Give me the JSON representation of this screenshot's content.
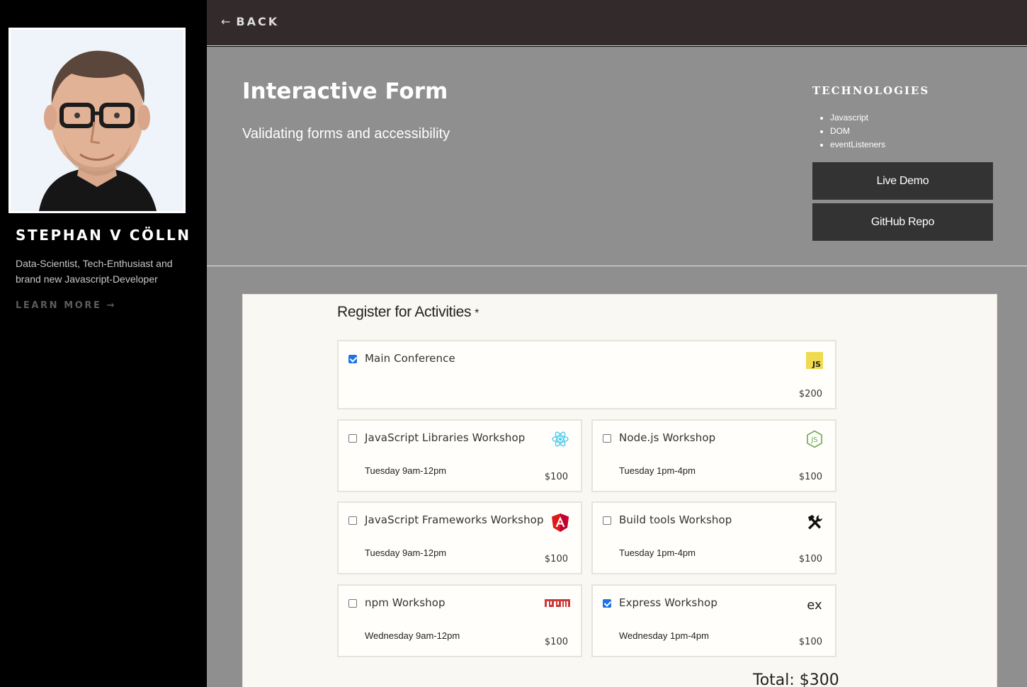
{
  "sidebar": {
    "name": "STEPHAN V CÖLLN",
    "bio": "Data-Scientist, Tech-Enthusiast and brand new Javascript-Developer",
    "learn_more": "LEARN MORE →"
  },
  "topbar": {
    "back_arrow": "←",
    "back_label": "BACK"
  },
  "project": {
    "title": "Interactive Form",
    "subtitle": "Validating forms and accessibility",
    "technologies_heading": "TECHNOLOGIES",
    "technologies": [
      "Javascript",
      "DOM",
      "eventListeners"
    ],
    "live_demo_label": "Live Demo",
    "github_label": "GitHub Repo"
  },
  "form": {
    "legend": "Register for Activities",
    "required_mark": "*",
    "activities": [
      {
        "title": "Main Conference",
        "time": "",
        "price": "$200",
        "checked": true,
        "icon": "javascript-icon"
      },
      {
        "title": "JavaScript Libraries Workshop",
        "time": "Tuesday 9am-12pm",
        "price": "$100",
        "checked": false,
        "icon": "react-icon"
      },
      {
        "title": "Node.js Workshop",
        "time": "Tuesday 1pm-4pm",
        "price": "$100",
        "checked": false,
        "icon": "nodejs-icon"
      },
      {
        "title": "JavaScript Frameworks Workshop",
        "time": "Tuesday 9am-12pm",
        "price": "$100",
        "checked": false,
        "icon": "angular-icon"
      },
      {
        "title": "Build tools Workshop",
        "time": "Tuesday 1pm-4pm",
        "price": "$100",
        "checked": false,
        "icon": "build-tools-icon"
      },
      {
        "title": "npm Workshop",
        "time": "Wednesday 9am-12pm",
        "price": "$100",
        "checked": false,
        "icon": "npm-icon"
      },
      {
        "title": "Express Workshop",
        "time": "Wednesday 1pm-4pm",
        "price": "$100",
        "checked": true,
        "icon": "express-icon"
      }
    ],
    "total": "Total: $300"
  },
  "colors": {
    "sidebar_bg": "#000000",
    "topbar_bg": "#332b2b",
    "main_bg": "#8f8f8f",
    "button_bg": "#333333",
    "checkbox_accent": "#1a73e8"
  }
}
